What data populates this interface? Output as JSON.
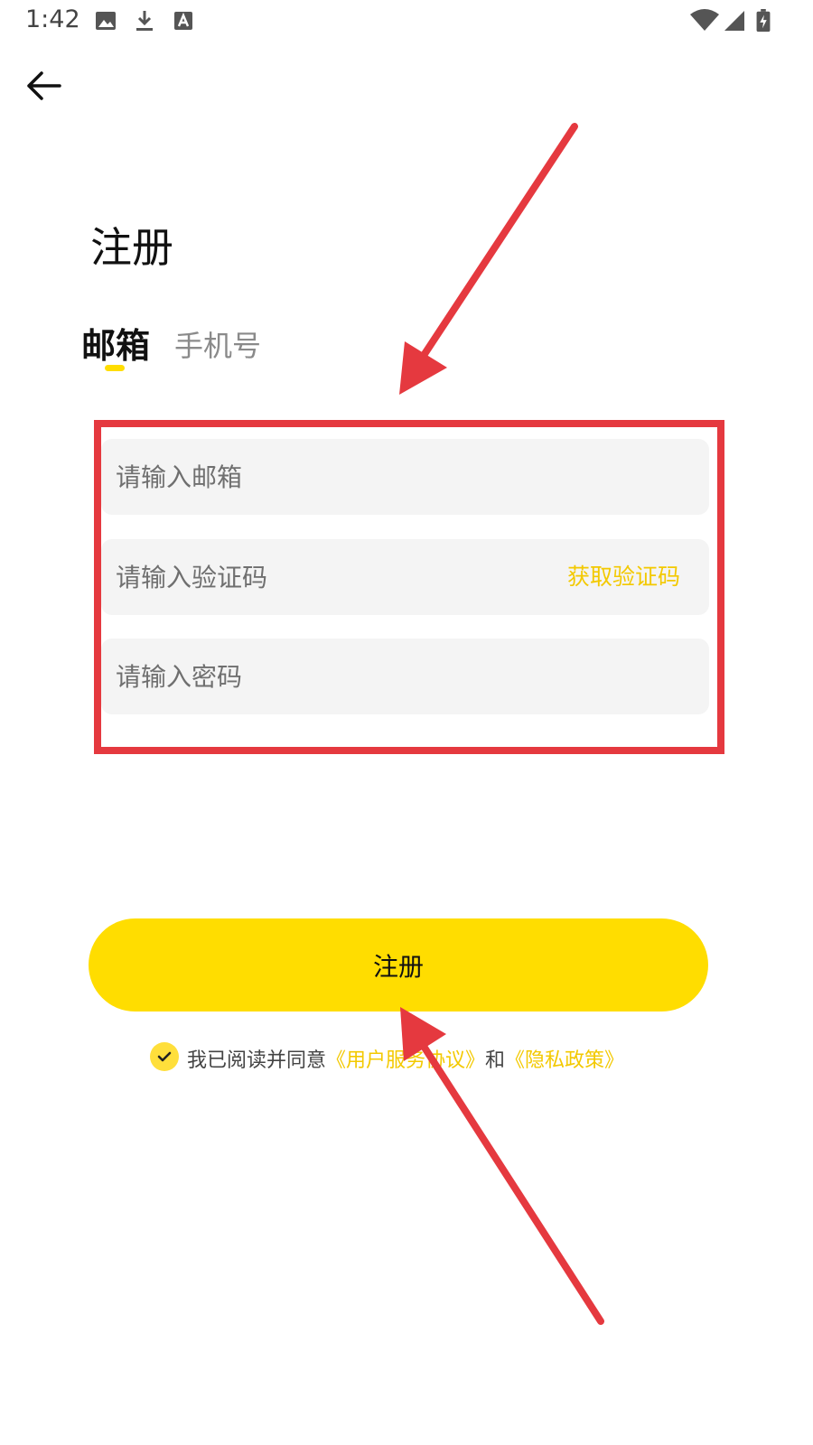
{
  "status_bar": {
    "time": "1:42",
    "left_icons": [
      "image-icon",
      "download-icon",
      "font-a-icon"
    ],
    "right_icons": [
      "wifi-icon",
      "signal-icon",
      "battery-charging-icon"
    ]
  },
  "nav": {
    "back_icon": "back-arrow-icon"
  },
  "page": {
    "title": "注册"
  },
  "tabs": [
    {
      "label": "邮箱",
      "active": true
    },
    {
      "label": "手机号",
      "active": false
    }
  ],
  "form": {
    "email_placeholder": "请输入邮箱",
    "code_placeholder": "请输入验证码",
    "get_code_label": "获取验证码",
    "password_placeholder": "请输入密码"
  },
  "submit_label": "注册",
  "agreement": {
    "checked": true,
    "prefix": "我已阅读并同意",
    "terms_link": "《用户服务协议》",
    "and_text": "和",
    "privacy_link": "《隐私政策》"
  },
  "colors": {
    "accent": "#ffdd00",
    "link": "#f3c900",
    "annotation": "#e5393f",
    "field_bg": "#f4f4f4"
  }
}
